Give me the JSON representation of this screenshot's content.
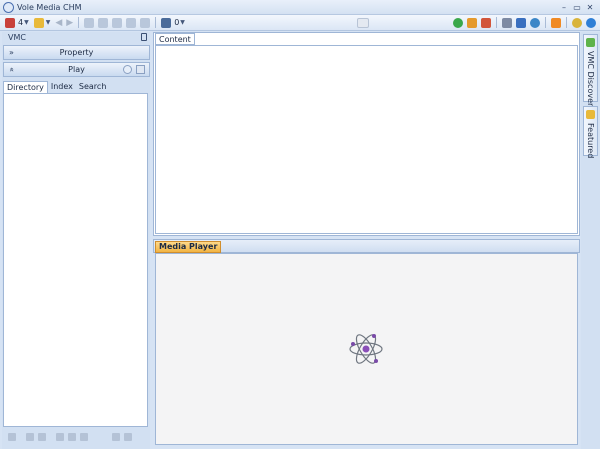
{
  "window": {
    "title": "Vole Media CHM",
    "minimize_icon": "minimize-icon",
    "maximize_icon": "maximize-icon",
    "close_icon": "close-icon"
  },
  "toolbar": {
    "library_count": "4",
    "player_count": "0",
    "icons": [
      "library-icon",
      "grid-icon",
      "back-arrow-icon",
      "forward-arrow-icon",
      "print-icon",
      "copy-icon",
      "bookmark-icon",
      "export-icon",
      "fullscreen-icon",
      "chat-icon",
      "add-icon",
      "tools-icon",
      "rocket-icon",
      "columns-icon",
      "shield-icon",
      "user-icon",
      "rss-icon",
      "power-icon",
      "info-icon"
    ]
  },
  "left_panel": {
    "header": "VMC",
    "property_label": "Property",
    "play_label": "Play",
    "tabs": [
      "Directory",
      "Index",
      "Search"
    ],
    "active_tab": "Directory"
  },
  "content": {
    "tab_label": "Content"
  },
  "media": {
    "tab_label": "Media Player"
  },
  "right_strip": {
    "discovery_label": "VMC Discovery",
    "featured_label": "Featured"
  },
  "colors": {
    "accent_orange": "#f2b443",
    "frame_blue": "#d2e0f2",
    "border_blue": "#9fb6d6"
  }
}
